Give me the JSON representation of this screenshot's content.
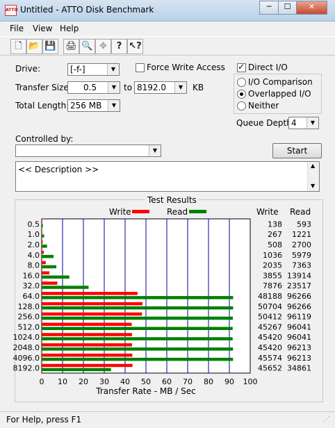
{
  "window": {
    "title": "Untitled - ATTO Disk Benchmark",
    "app_icon": "ATTO",
    "min": "─",
    "max": "☐",
    "close": "✕"
  },
  "menu": [
    "File",
    "View",
    "Help"
  ],
  "toolbar": {
    "icons": [
      "new-file-icon",
      "open-folder-icon",
      "save-icon",
      "print-icon",
      "print-preview-icon",
      "move-icon",
      "help-icon",
      "context-help-icon"
    ],
    "glyphs": [
      "🗋",
      "📂",
      "💾",
      "🖨",
      "🔍",
      "✥",
      "?",
      "↖?"
    ]
  },
  "form": {
    "drive_label": "Drive:",
    "drive_value": "[-f-]",
    "force_write_label": "Force Write Access",
    "force_write_checked": false,
    "direct_io_label": "Direct I/O",
    "direct_io_checked": true,
    "transfer_label": "Transfer Size:",
    "transfer_from": "0.5",
    "to_label": "to",
    "transfer_to": "8192.0",
    "kb_label": "KB",
    "total_length_label": "Total Length:",
    "total_length_value": "256 MB",
    "io_comparison": "I/O Comparison",
    "overlapped_io": "Overlapped I/O",
    "neither": "Neither",
    "selected_mode": "Overlapped I/O",
    "queue_depth_label": "Queue Depth:",
    "queue_depth_value": "4",
    "controlled_by_label": "Controlled by:",
    "controlled_by_value": "",
    "start_label": "Start",
    "description": "<< Description >>"
  },
  "results": {
    "group_title": "Test Results",
    "write_legend": "Write",
    "read_legend": "Read",
    "write_header": "Write",
    "read_header": "Read"
  },
  "colors": {
    "write": "#ff0000",
    "read": "#008000",
    "grid": "#0000a0"
  },
  "chart_data": {
    "type": "bar",
    "orientation": "horizontal",
    "categories": [
      "0.5",
      "1.0",
      "2.0",
      "4.0",
      "8.0",
      "16.0",
      "32.0",
      "64.0",
      "128.0",
      "256.0",
      "512.0",
      "1024.0",
      "2048.0",
      "4096.0",
      "8192.0"
    ],
    "series": [
      {
        "name": "Write",
        "values": [
          0.13,
          0.25,
          0.48,
          0.99,
          1.94,
          3.68,
          7.51,
          45.96,
          48.35,
          48.08,
          43.17,
          43.32,
          43.32,
          43.46,
          43.54
        ]
      },
      {
        "name": "Read",
        "values": [
          0.57,
          1.16,
          2.57,
          5.7,
          7.02,
          13.27,
          22.48,
          91.81,
          91.81,
          91.67,
          91.59,
          91.59,
          91.75,
          91.75,
          33.25
        ]
      }
    ],
    "write_text": [
      "138",
      "267",
      "508",
      "1036",
      "2035",
      "3855",
      "7876",
      "48188",
      "50704",
      "50412",
      "45267",
      "45420",
      "45420",
      "45574",
      "45652"
    ],
    "read_text": [
      "593",
      "1221",
      "2700",
      "5979",
      "7363",
      "13914",
      "23517",
      "96266",
      "96266",
      "96119",
      "96041",
      "96041",
      "96213",
      "96213",
      "34861"
    ],
    "xticks": [
      "0",
      "10",
      "20",
      "30",
      "40",
      "50",
      "60",
      "70",
      "80",
      "90",
      "100"
    ],
    "xlabel": "Transfer Rate - MB / Sec",
    "xlim": [
      0,
      100
    ],
    "grid": true
  },
  "status": "For Help, press F1"
}
